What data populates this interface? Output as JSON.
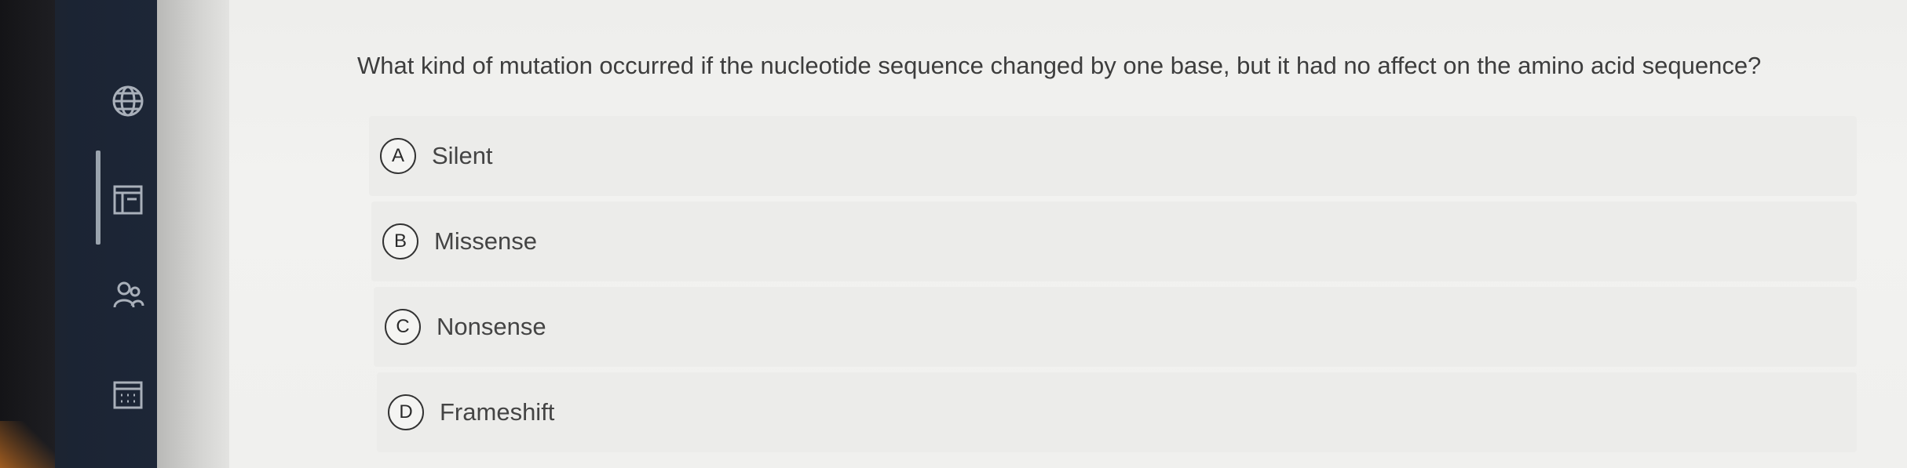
{
  "question": {
    "text": "What kind of mutation occurred if the nucleotide sequence changed by one base, but it had no affect on the amino acid sequence?"
  },
  "options": [
    {
      "letter": "A",
      "label": "Silent"
    },
    {
      "letter": "B",
      "label": "Missense"
    },
    {
      "letter": "C",
      "label": "Nonsense"
    },
    {
      "letter": "D",
      "label": "Frameshift"
    }
  ],
  "sidebar": {
    "icons": [
      "globe-icon",
      "document-icon",
      "people-icon",
      "calendar-icon"
    ]
  },
  "colors": {
    "sidebar": "#1d2637",
    "background": "#f0f0ee",
    "option_bg": "#ececea",
    "text": "#3d3d3d"
  }
}
